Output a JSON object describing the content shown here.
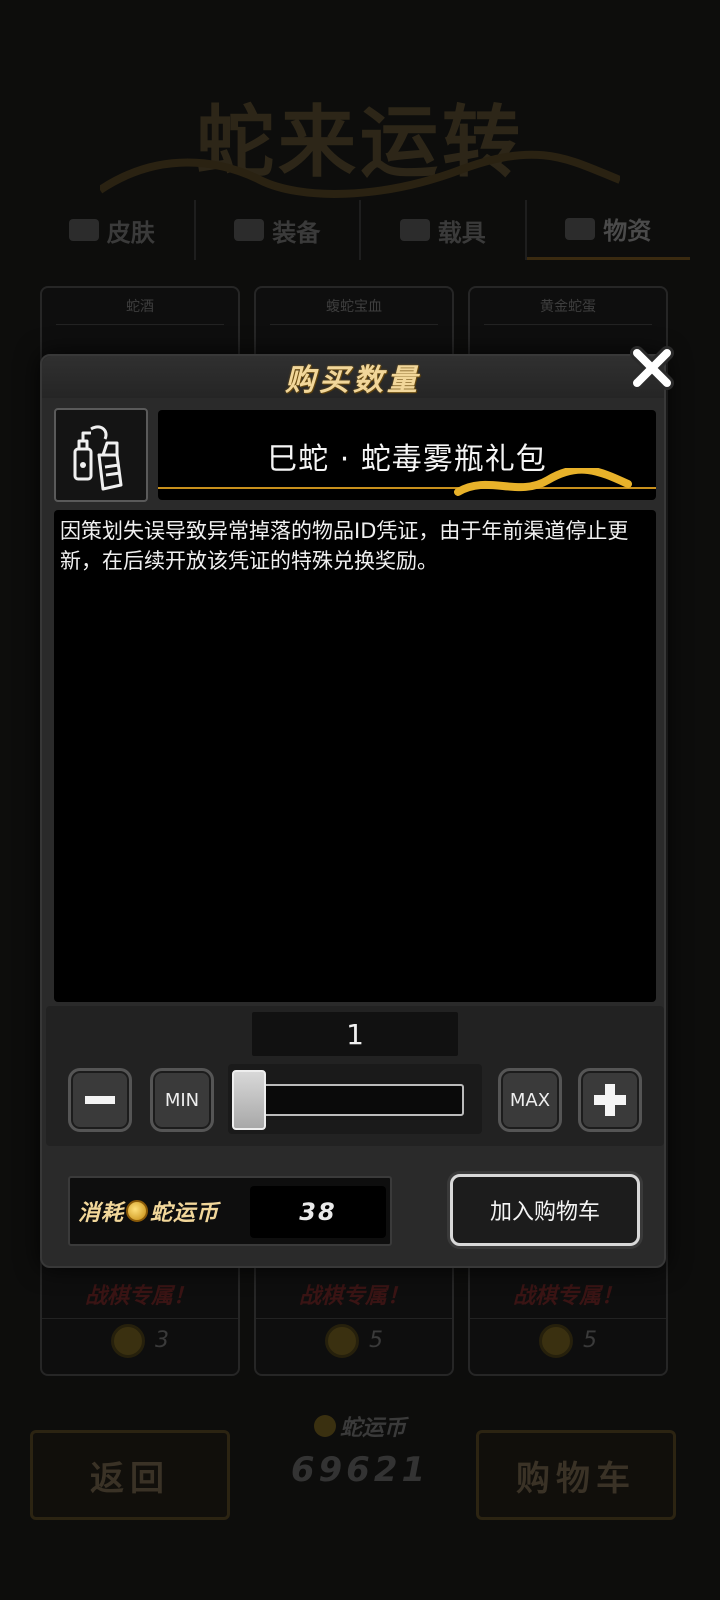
{
  "background": {
    "banner_title": "蛇来运转",
    "tabs": [
      {
        "label": "皮肤",
        "icon": "box-icon"
      },
      {
        "label": "装备",
        "icon": "shield-icon"
      },
      {
        "label": "载具",
        "icon": "car-icon"
      },
      {
        "label": "物资",
        "icon": "crate-icon"
      }
    ],
    "cards": [
      {
        "name": "蛇酒",
        "tag": "战棋专属！",
        "price": "3"
      },
      {
        "name": "蝮蛇宝血",
        "tag": "战棋专属！",
        "price": "5"
      },
      {
        "name": "黄金蛇蛋",
        "tag": "战棋专属！",
        "price": "5"
      }
    ],
    "back_label": "返回",
    "wallet_label": "蛇运币",
    "wallet_amount": "69621",
    "cart_label": "购物车"
  },
  "modal": {
    "title": "购买数量",
    "item_name": "巳蛇 · 蛇毒雾瓶礼包",
    "item_icon": "spray-bottles-icon",
    "description": "因策划失误导致异常掉落的物品ID凭证，由于年前渠道停止更新，在后续开放该凭证的特殊兑换奖励。",
    "quantity": "1",
    "slider_fraction": 0.0,
    "min_label": "MIN",
    "max_label": "MAX",
    "cost_label_prefix": "消耗",
    "cost_label_currency": "蛇运币",
    "cost_value": "38",
    "add_to_cart_label": "加入购物车"
  },
  "colors": {
    "title_gold": "#f2d79a",
    "modal_bg": "#2a2a2a",
    "panel_black": "#000000"
  }
}
